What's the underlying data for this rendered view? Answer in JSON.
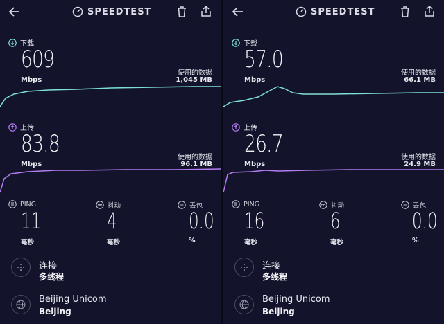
{
  "panels": [
    {
      "brand": "SPEEDTEST",
      "download": {
        "label": "下载",
        "value": "609",
        "unit": "Mbps",
        "used_label": "使用的数据",
        "used_value": "1,045 MB"
      },
      "upload": {
        "label": "上传",
        "value": "83.8",
        "unit": "Mbps",
        "used_label": "使用的数据",
        "used_value": "96.1 MB"
      },
      "ping": {
        "label": "PING",
        "value": "11",
        "unit": "毫秒"
      },
      "jitter": {
        "label": "抖动",
        "value": "4",
        "unit": "毫秒"
      },
      "loss": {
        "label": "丢包",
        "value": "0.0",
        "unit": "%"
      },
      "connection": {
        "title": "连接",
        "value": "多线程"
      },
      "server": {
        "title": "Beijing Unicom",
        "value": "Beijing"
      }
    },
    {
      "brand": "SPEEDTEST",
      "download": {
        "label": "下载",
        "value": "57.0",
        "unit": "Mbps",
        "used_label": "使用的数据",
        "used_value": "66.1 MB"
      },
      "upload": {
        "label": "上传",
        "value": "26.7",
        "unit": "Mbps",
        "used_label": "使用的数据",
        "used_value": "24.9 MB"
      },
      "ping": {
        "label": "PING",
        "value": "16",
        "unit": "毫秒"
      },
      "jitter": {
        "label": "抖动",
        "value": "6",
        "unit": "毫秒"
      },
      "loss": {
        "label": "丢包",
        "value": "0.0",
        "unit": "%"
      },
      "connection": {
        "title": "连接",
        "value": "多线程"
      },
      "server": {
        "title": "Beijing Unicom",
        "value": "Beijing"
      }
    }
  ],
  "colors": {
    "download": "#7fe0d6",
    "upload": "#b57cf2",
    "background": "#13142b"
  }
}
